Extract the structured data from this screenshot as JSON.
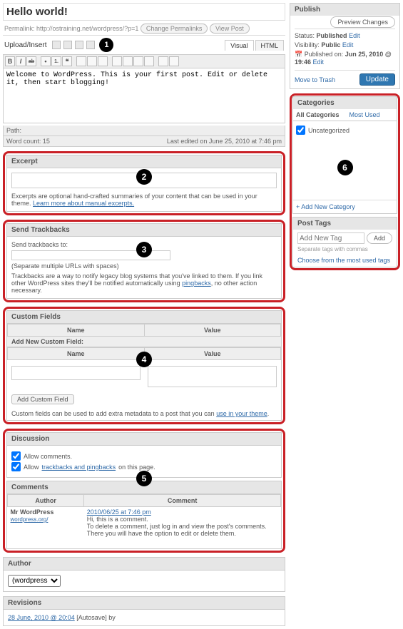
{
  "title": "Hello world!",
  "permalink": {
    "label": "Permalink:",
    "url": "http://ostraining.net/wordpress/?p=1",
    "change_btn": "Change Permalinks",
    "view_btn": "View Post"
  },
  "upload_insert": "Upload/Insert",
  "editor": {
    "tabs": {
      "visual": "Visual",
      "html": "HTML"
    },
    "content": "Welcome to WordPress. This is your first post. Edit or delete it, then start blogging!",
    "path_label": "Path:",
    "word_count_label": "Word count:",
    "word_count": "15",
    "last_edit": "Last edited on June 25, 2010 at 7:46 pm"
  },
  "excerpt": {
    "title": "Excerpt",
    "help": "Excerpts are optional hand-crafted summaries of your content that can be used in your theme. ",
    "link": "Learn more about manual excerpts."
  },
  "trackbacks": {
    "title": "Send Trackbacks",
    "to_label": "Send trackbacks to:",
    "note1": "(Separate multiple URLs with spaces)",
    "note2a": "Trackbacks are a way to notify legacy blog systems that you've linked to them. If you link other WordPress sites they'll be notified automatically using ",
    "note2_link": "pingbacks",
    "note2b": ", no other action necessary."
  },
  "custom_fields": {
    "title": "Custom Fields",
    "name_hdr": "Name",
    "value_hdr": "Value",
    "add_new_label": "Add New Custom Field:",
    "add_btn": "Add Custom Field",
    "help_a": "Custom fields can be used to add extra metadata to a post that you can ",
    "help_link": "use in your theme",
    "help_b": "."
  },
  "discussion": {
    "title": "Discussion",
    "allow_comments": "Allow comments.",
    "allow_tb_a": "Allow ",
    "allow_tb_link": "trackbacks and pingbacks",
    "allow_tb_b": " on this page."
  },
  "comments": {
    "title": "Comments",
    "author_hdr": "Author",
    "comment_hdr": "Comment",
    "author_name": "Mr WordPress",
    "author_site": "wordpress.org/",
    "meta": "2010/06/25 at 7:46 pm",
    "body": "Hi, this is a comment.\nTo delete a comment, just log in and view the post's comments. There you will have the option to edit or delete them."
  },
  "author_box": {
    "title": "Author",
    "selected": "(wordpress"
  },
  "revisions": {
    "title": "Revisions",
    "item": "28 June, 2010 @ 20:04",
    "suffix": " [Autosave] by"
  },
  "publish": {
    "title": "Publish",
    "preview_btn": "Preview Changes",
    "status_label": "Status:",
    "status_value": "Published",
    "edit": "Edit",
    "visibility_label": "Visibility:",
    "visibility_value": "Public",
    "published_label": "Published on:",
    "published_value": "Jun 25, 2010 @ 19:46",
    "trash": "Move to Trash",
    "update_btn": "Update"
  },
  "categories": {
    "title": "Categories",
    "tab_all": "All Categories",
    "tab_used": "Most Used",
    "items": [
      {
        "label": "Uncategorized",
        "checked": true
      }
    ],
    "add_link": "+ Add New Category"
  },
  "post_tags": {
    "title": "Post Tags",
    "placeholder": "Add New Tag",
    "add_btn": "Add",
    "note": "Separate tags with commas",
    "choose": "Choose from the most used tags"
  },
  "badges": {
    "b1": "1",
    "b2": "2",
    "b3": "3",
    "b4": "4",
    "b5": "5",
    "b6": "6"
  }
}
